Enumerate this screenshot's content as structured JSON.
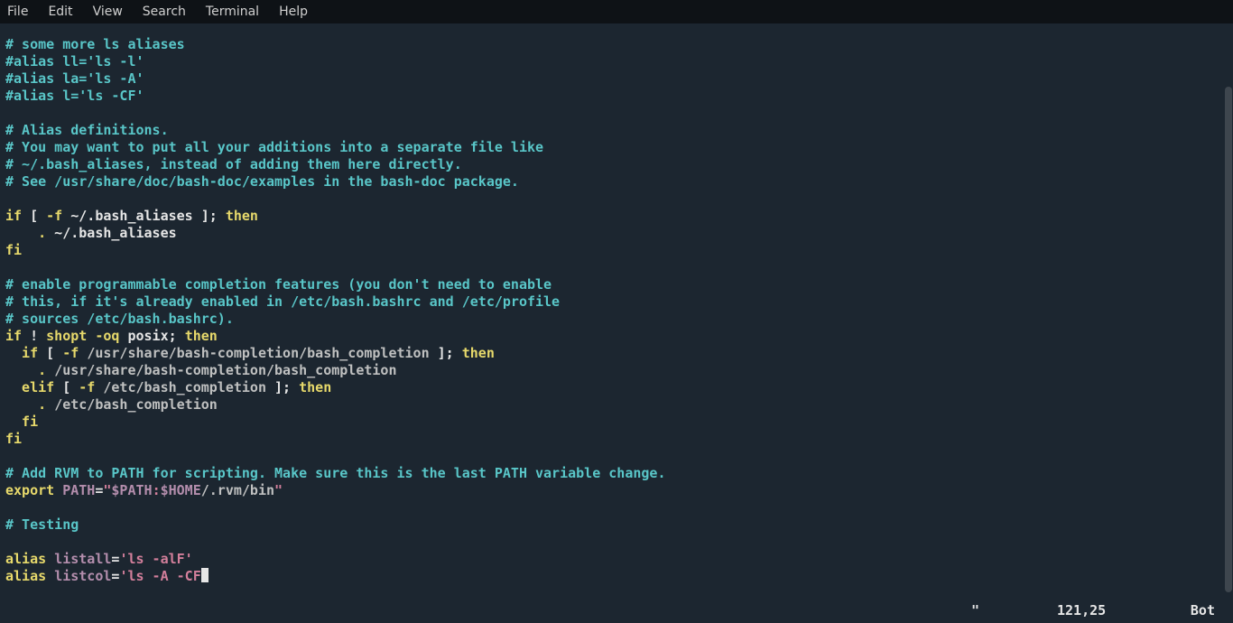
{
  "menu": {
    "items": [
      "File",
      "Edit",
      "View",
      "Search",
      "Terminal",
      "Help"
    ]
  },
  "code": {
    "l1": "# some more ls aliases",
    "l2": "#alias ll='ls -l'",
    "l3": "#alias la='ls -A'",
    "l4": "#alias l='ls -CF'",
    "l5": "",
    "l6": "# Alias definitions.",
    "l7": "# You may want to put all your additions into a separate file like",
    "l8": "# ~/.bash_aliases, instead of adding them here directly.",
    "l9": "# See /usr/share/doc/bash-doc/examples in the bash-doc package.",
    "l10": "",
    "l11a": "if",
    "l11b": " [ ",
    "l11c": "-f",
    "l11d": " ~/.bash_aliases ]; ",
    "l11e": "then",
    "l12a": "    ",
    "l12b": ".",
    "l12c": " ~/.bash_aliases",
    "l13": "fi",
    "l14": "",
    "l15": "# enable programmable completion features (you don't need to enable",
    "l16": "# this, if it's already enabled in /etc/bash.bashrc and /etc/profile",
    "l17": "# sources /etc/bash.bashrc).",
    "l18a": "if",
    "l18b": " ! ",
    "l18c": "shopt -oq",
    "l18d": " posix; ",
    "l18e": "then",
    "l19a": "  if",
    "l19b": " [ ",
    "l19c": "-f",
    "l19d": " ",
    "l19e": "/usr/share/bash-completion/bash_completion",
    "l19f": " ]; ",
    "l19g": "then",
    "l20a": "    ",
    "l20b": ".",
    "l20c": " ",
    "l20d": "/usr/share/bash-completion/bash_completion",
    "l21a": "  elif",
    "l21b": " [ ",
    "l21c": "-f",
    "l21d": " ",
    "l21e": "/etc/bash_completion",
    "l21f": " ]; ",
    "l21g": "then",
    "l22a": "    ",
    "l22b": ".",
    "l22c": " ",
    "l22d": "/etc/bash_completion",
    "l23": "  fi",
    "l24": "fi",
    "l25": "",
    "l26": "# Add RVM to PATH for scripting. Make sure this is the last PATH variable change.",
    "l27a": "export",
    "l27b": " ",
    "l27c": "PATH",
    "l27d": "=",
    "l27e": "\"",
    "l27f": "$PATH",
    "l27g": ":",
    "l27h": "$HOME",
    "l27i": "/.rvm/bin",
    "l27j": "\"",
    "l28": "",
    "l29": "# Testing",
    "l30": "",
    "l31a": "alias",
    "l31b": " ",
    "l31c": "listall",
    "l31d": "=",
    "l31e": "'ls -alF'",
    "l32a": "alias",
    "l32b": " ",
    "l32c": "listcol",
    "l32d": "=",
    "l32e": "'ls -A -CF"
  },
  "status": {
    "quote": "\"",
    "position": "121,25",
    "scroll": "Bot"
  }
}
